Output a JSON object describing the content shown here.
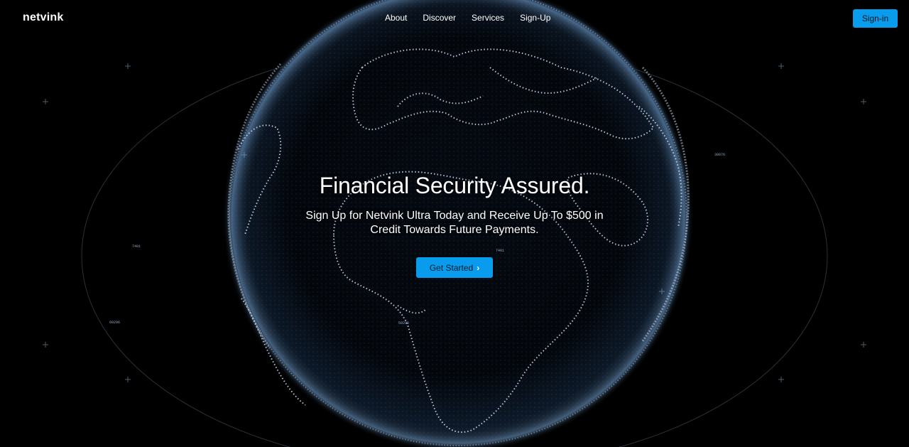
{
  "nav": {
    "logo": "netvink",
    "links": [
      "About",
      "Discover",
      "Services",
      "Sign-Up"
    ],
    "signin_label": "Sign-in"
  },
  "hero": {
    "title": "Financial Security Assured.",
    "subtitle": "Sign Up for Netvink Ultra Today and Receive Up To $500 in Credit Towards Future Payments.",
    "cta_label": "Get Started",
    "cta_icon": "chevron-right-icon"
  },
  "background": {
    "image": "dotted-globe-illustration",
    "colors": {
      "base": "#000000",
      "globe_glow": "#9fc7f0",
      "accent": "#0a9cec"
    },
    "readouts": [
      "60296",
      "50298",
      "38076",
      "7401",
      "7401"
    ]
  }
}
